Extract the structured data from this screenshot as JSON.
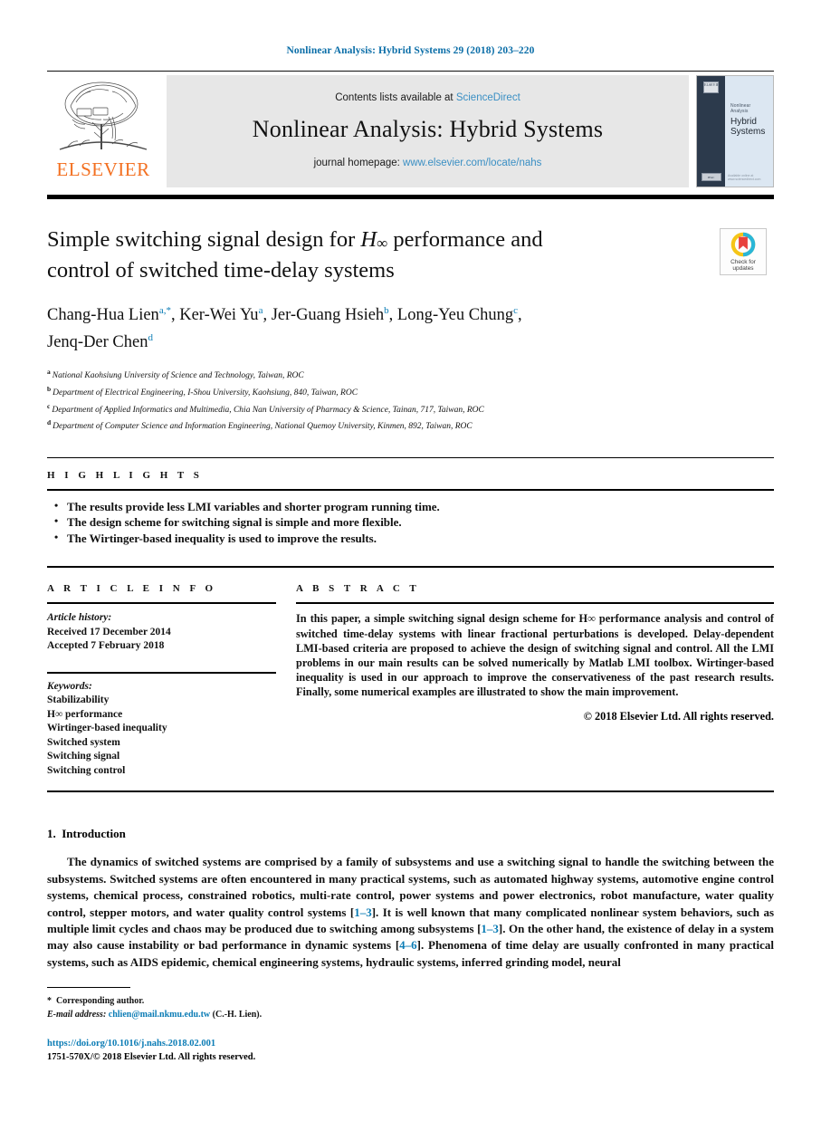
{
  "running_head": "Nonlinear Analysis: Hybrid Systems 29 (2018) 203–220",
  "masthead": {
    "publisher_logo_label": "ELSEVIER",
    "contents_prefix": "Contents lists available at ",
    "contents_link": "ScienceDirect",
    "journal_title": "Nonlinear Analysis: Hybrid Systems",
    "homepage_prefix": "journal homepage: ",
    "homepage_link": "www.elsevier.com/locate/nahs",
    "cover": {
      "sub_title": "Nonlinear Analysis",
      "main_title_line1": "Hybrid",
      "main_title_line2": "Systems",
      "mini_logo_label": "ELSEVIER",
      "ifac_label": "IFAC",
      "footer_label": "Available online at www.sciencedirect.com"
    }
  },
  "article": {
    "title_line1_pre": "Simple switching signal design for ",
    "title_math": "H",
    "title_math_sub": "∞",
    "title_line1_post": " performance and",
    "title_line2": "control of switched time-delay systems",
    "authors": [
      {
        "name": "Chang-Hua Lien",
        "marks": "a,*",
        "sep": ", "
      },
      {
        "name": "Ker-Wei Yu",
        "marks": "a",
        "sep": ", "
      },
      {
        "name": "Jer-Guang Hsieh",
        "marks": "b",
        "sep": ", "
      },
      {
        "name": "Long-Yeu Chung",
        "marks": "c",
        "sep": ","
      },
      {
        "name": "Jenq-Der Chen",
        "marks": "d",
        "sep": ""
      }
    ],
    "affiliations": [
      {
        "mark": "a",
        "text": "National Kaohsiung University of Science and Technology, Taiwan, ROC"
      },
      {
        "mark": "b",
        "text": "Department of Electrical Engineering, I-Shou University, Kaohsiung, 840, Taiwan, ROC"
      },
      {
        "mark": "c",
        "text": "Department of Applied Informatics and Multimedia, Chia Nan University of Pharmacy & Science, Tainan, 717, Taiwan, ROC"
      },
      {
        "mark": "d",
        "text": "Department of Computer Science and Information Engineering, National Quemoy University, Kinmen, 892, Taiwan, ROC"
      }
    ],
    "crossmark_line1": "Check for",
    "crossmark_line2": "updates"
  },
  "highlights": {
    "heading": "H I G H L I G H T S",
    "items": [
      "The results provide less LMI variables and shorter program running time.",
      "The design scheme for switching signal is simple and more flexible.",
      "The Wirtinger-based inequality is used to improve the results."
    ]
  },
  "article_info": {
    "heading": "A R T I C L E   I N F O",
    "history_label": "Article history:",
    "history": [
      "Received 17 December 2014",
      "Accepted 7 February 2018"
    ],
    "keywords_label": "Keywords:",
    "keywords": [
      "Stabilizability",
      "H∞ performance",
      "Wirtinger-based inequality",
      "Switched system",
      "Switching signal",
      "Switching control"
    ]
  },
  "abstract": {
    "heading": "A B S T R A C T",
    "text": "In this paper, a simple switching signal design scheme for H∞ performance analysis and control of switched time-delay systems with linear fractional perturbations is developed. Delay-dependent LMI-based criteria are proposed to achieve the design of switching signal and control. All the LMI problems in our main results can be solved numerically by Matlab LMI toolbox. Wirtinger-based inequality is used in our approach to improve the conservativeness of the past research results. Finally, some numerical examples are illustrated to show the main improvement.",
    "copyright": "© 2018 Elsevier Ltd. All rights reserved."
  },
  "introduction": {
    "number": "1.",
    "title": "Introduction",
    "paragraph_parts": [
      {
        "t": "The dynamics of switched systems are comprised by a family of subsystems and use a switching signal to handle the switching between the subsystems. Switched systems are often encountered in many practical systems, such as automated highway systems, automotive engine control systems, chemical process, constrained robotics, multi-rate control, power systems and power electronics, robot manufacture, water quality control, stepper motors, and water quality control systems ["
      },
      {
        "t": "1–3",
        "link": true
      },
      {
        "t": "]. It is well known that many complicated nonlinear system behaviors, such as multiple limit cycles and chaos may be produced due to switching among subsystems ["
      },
      {
        "t": "1–3",
        "link": true
      },
      {
        "t": "]. On the other hand, the existence of delay in a system may also cause instability or bad performance in dynamic systems ["
      },
      {
        "t": "4–6",
        "link": true
      },
      {
        "t": "]. Phenomena of time delay are usually confronted in many practical systems, such as AIDS epidemic, chemical engineering systems, hydraulic systems, inferred grinding model, neural"
      }
    ]
  },
  "footnote": {
    "star": "*",
    "corresponding": "Corresponding author.",
    "email_label": "E-mail address:",
    "email": "chlien@mail.nkmu.edu.tw",
    "email_owner": "(C.-H. Lien)."
  },
  "page_footer": {
    "doi": "https://doi.org/10.1016/j.nahs.2018.02.001",
    "issn_line": "1751-570X/© 2018 Elsevier Ltd. All rights reserved."
  },
  "colors": {
    "link_blue": "#0b7cb5",
    "sd_blue": "#3a8fc4",
    "elsevier_orange": "#f37021",
    "band_gray": "#e7e7e7"
  }
}
